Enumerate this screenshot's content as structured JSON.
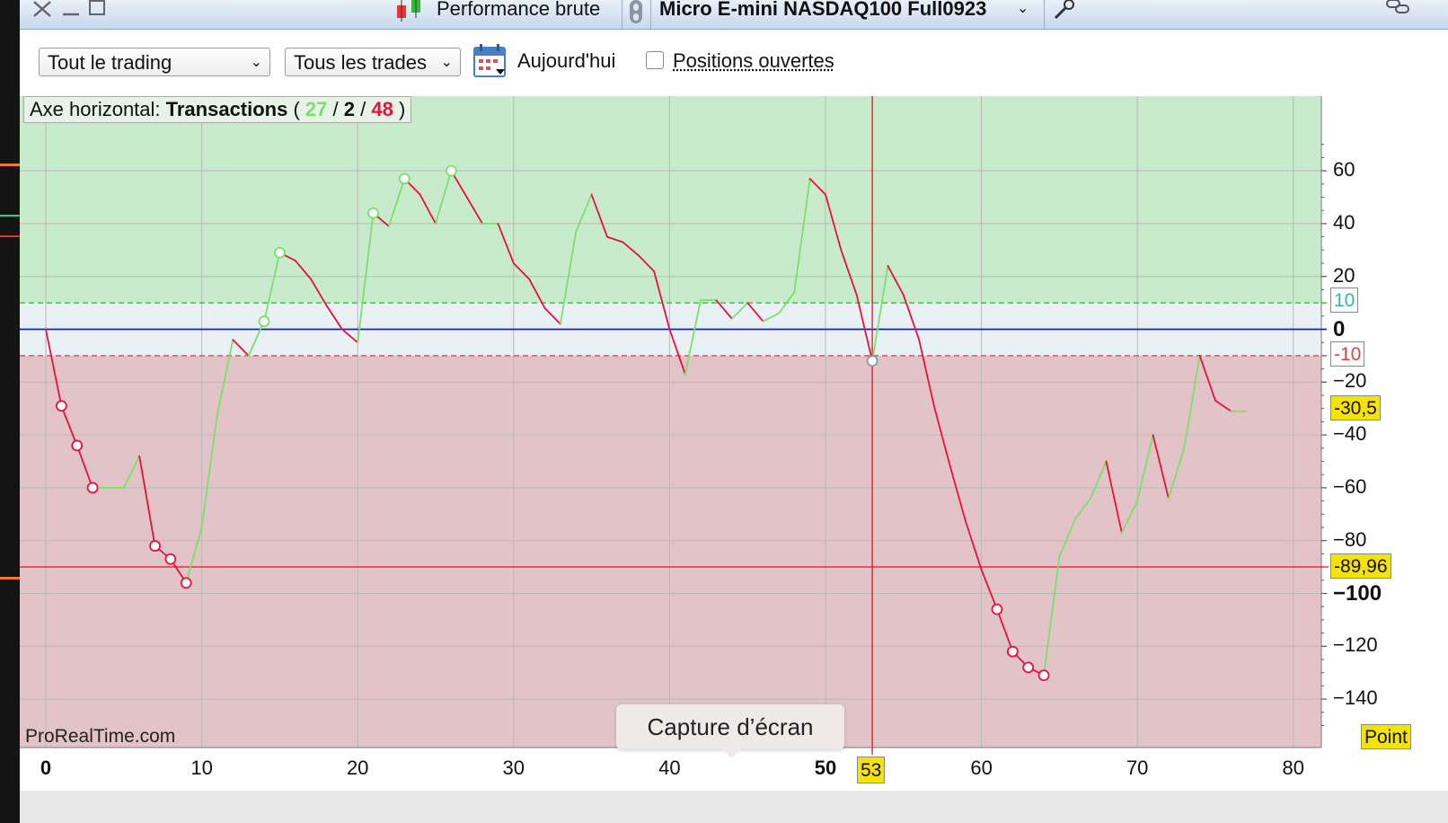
{
  "window": {
    "title": "Performance brute",
    "instrument": "Micro E-mini NASDAQ100 Full0923"
  },
  "toolbar": {
    "scope_select": "Tout le trading",
    "trades_select": "Tous les trades",
    "date_label": "Aujourd'hui",
    "open_positions_label": "Positions ouvertes",
    "open_positions_checked": false
  },
  "legend": {
    "prefix": "Axe horizontal: ",
    "bold": "Transactions",
    "open_paren": " ( ",
    "winners": "27",
    "sep1": " / ",
    "neutral": "2",
    "sep2": " / ",
    "losers": "48",
    "close_paren": " )"
  },
  "tooltip": "Capture d’écran",
  "watermark": "ProRealTime.com",
  "unit_tag": "Point",
  "crosshair": {
    "x_value": "53",
    "y_value": "-89,96"
  },
  "last_value_tag": "-30,5",
  "threshold_tags": {
    "upper": "10",
    "lower": "-10"
  },
  "colors": {
    "gain_zone": "#c8eccb",
    "loss_zone": "#e2c4c8",
    "neutral_zone": "#eaf1f4",
    "up_segment": "#7be06a",
    "down_segment": "#e8103c",
    "crosshair": "#e81020",
    "zero_line": "#1626a0"
  },
  "chart_data": {
    "type": "line",
    "xlabel": "",
    "ylabel": "",
    "xlim": [
      0,
      82
    ],
    "ylim": [
      -160,
      80
    ],
    "x_ticks": [
      "0",
      "10",
      "20",
      "30",
      "40",
      "50",
      "60",
      "70",
      "80"
    ],
    "y_ticks": [
      "60",
      "40",
      "20",
      "0",
      "-20",
      "-40",
      "-60",
      "-80",
      "-100",
      "-120",
      "-140"
    ],
    "thresholds": [
      10,
      -10
    ],
    "points": [
      [
        0,
        0
      ],
      [
        1,
        -29
      ],
      [
        2,
        -44
      ],
      [
        3,
        -60
      ],
      [
        4,
        -60
      ],
      [
        5,
        -60
      ],
      [
        6,
        -48
      ],
      [
        7,
        -82
      ],
      [
        8,
        -87
      ],
      [
        9,
        -96
      ],
      [
        10,
        -75
      ],
      [
        11,
        -32
      ],
      [
        12,
        -4
      ],
      [
        13,
        -10
      ],
      [
        14,
        3
      ],
      [
        15,
        29
      ],
      [
        16,
        26
      ],
      [
        17,
        19
      ],
      [
        18,
        9
      ],
      [
        19,
        0
      ],
      [
        20,
        -5
      ],
      [
        21,
        44
      ],
      [
        22,
        39
      ],
      [
        23,
        57
      ],
      [
        24,
        51
      ],
      [
        25,
        40
      ],
      [
        26,
        60
      ],
      [
        27,
        50
      ],
      [
        28,
        40
      ],
      [
        29,
        40
      ],
      [
        30,
        25
      ],
      [
        31,
        19
      ],
      [
        32,
        8
      ],
      [
        33,
        2
      ],
      [
        34,
        37
      ],
      [
        35,
        51
      ],
      [
        36,
        35
      ],
      [
        37,
        33
      ],
      [
        38,
        28
      ],
      [
        39,
        22
      ],
      [
        40,
        0
      ],
      [
        41,
        -17
      ],
      [
        42,
        11
      ],
      [
        43,
        11
      ],
      [
        44,
        4
      ],
      [
        45,
        10
      ],
      [
        46,
        3
      ],
      [
        47,
        6
      ],
      [
        48,
        14
      ],
      [
        49,
        57
      ],
      [
        50,
        51
      ],
      [
        51,
        30
      ],
      [
        52,
        13
      ],
      [
        53,
        -12
      ],
      [
        54,
        24
      ],
      [
        55,
        13
      ],
      [
        56,
        -4
      ],
      [
        57,
        -30
      ],
      [
        58,
        -52
      ],
      [
        59,
        -73
      ],
      [
        60,
        -91
      ],
      [
        61,
        -106
      ],
      [
        62,
        -122
      ],
      [
        63,
        -128
      ],
      [
        64,
        -131
      ],
      [
        65,
        -86
      ],
      [
        66,
        -72
      ],
      [
        67,
        -64
      ],
      [
        68,
        -50
      ],
      [
        69,
        -77
      ],
      [
        70,
        -65
      ],
      [
        71,
        -40
      ],
      [
        72,
        -64
      ],
      [
        73,
        -45
      ],
      [
        74,
        -10
      ],
      [
        75,
        -27
      ],
      [
        76,
        -31
      ],
      [
        77,
        -31
      ]
    ],
    "markers": [
      {
        "x": 1,
        "y": -29,
        "kind": "loss"
      },
      {
        "x": 2,
        "y": -44,
        "kind": "loss"
      },
      {
        "x": 3,
        "y": -60,
        "kind": "loss"
      },
      {
        "x": 7,
        "y": -82,
        "kind": "loss"
      },
      {
        "x": 8,
        "y": -87,
        "kind": "loss"
      },
      {
        "x": 9,
        "y": -96,
        "kind": "loss"
      },
      {
        "x": 14,
        "y": 3,
        "kind": "win"
      },
      {
        "x": 15,
        "y": 29,
        "kind": "win"
      },
      {
        "x": 21,
        "y": 44,
        "kind": "win"
      },
      {
        "x": 23,
        "y": 57,
        "kind": "win"
      },
      {
        "x": 26,
        "y": 60,
        "kind": "win"
      },
      {
        "x": 53,
        "y": -12,
        "kind": "neutral"
      },
      {
        "x": 61,
        "y": -106,
        "kind": "loss"
      },
      {
        "x": 62,
        "y": -122,
        "kind": "loss"
      },
      {
        "x": 63,
        "y": -128,
        "kind": "loss"
      },
      {
        "x": 64,
        "y": -131,
        "kind": "loss"
      }
    ],
    "crosshair_x": 53,
    "crosshair_y": -89.96,
    "grid": true
  }
}
